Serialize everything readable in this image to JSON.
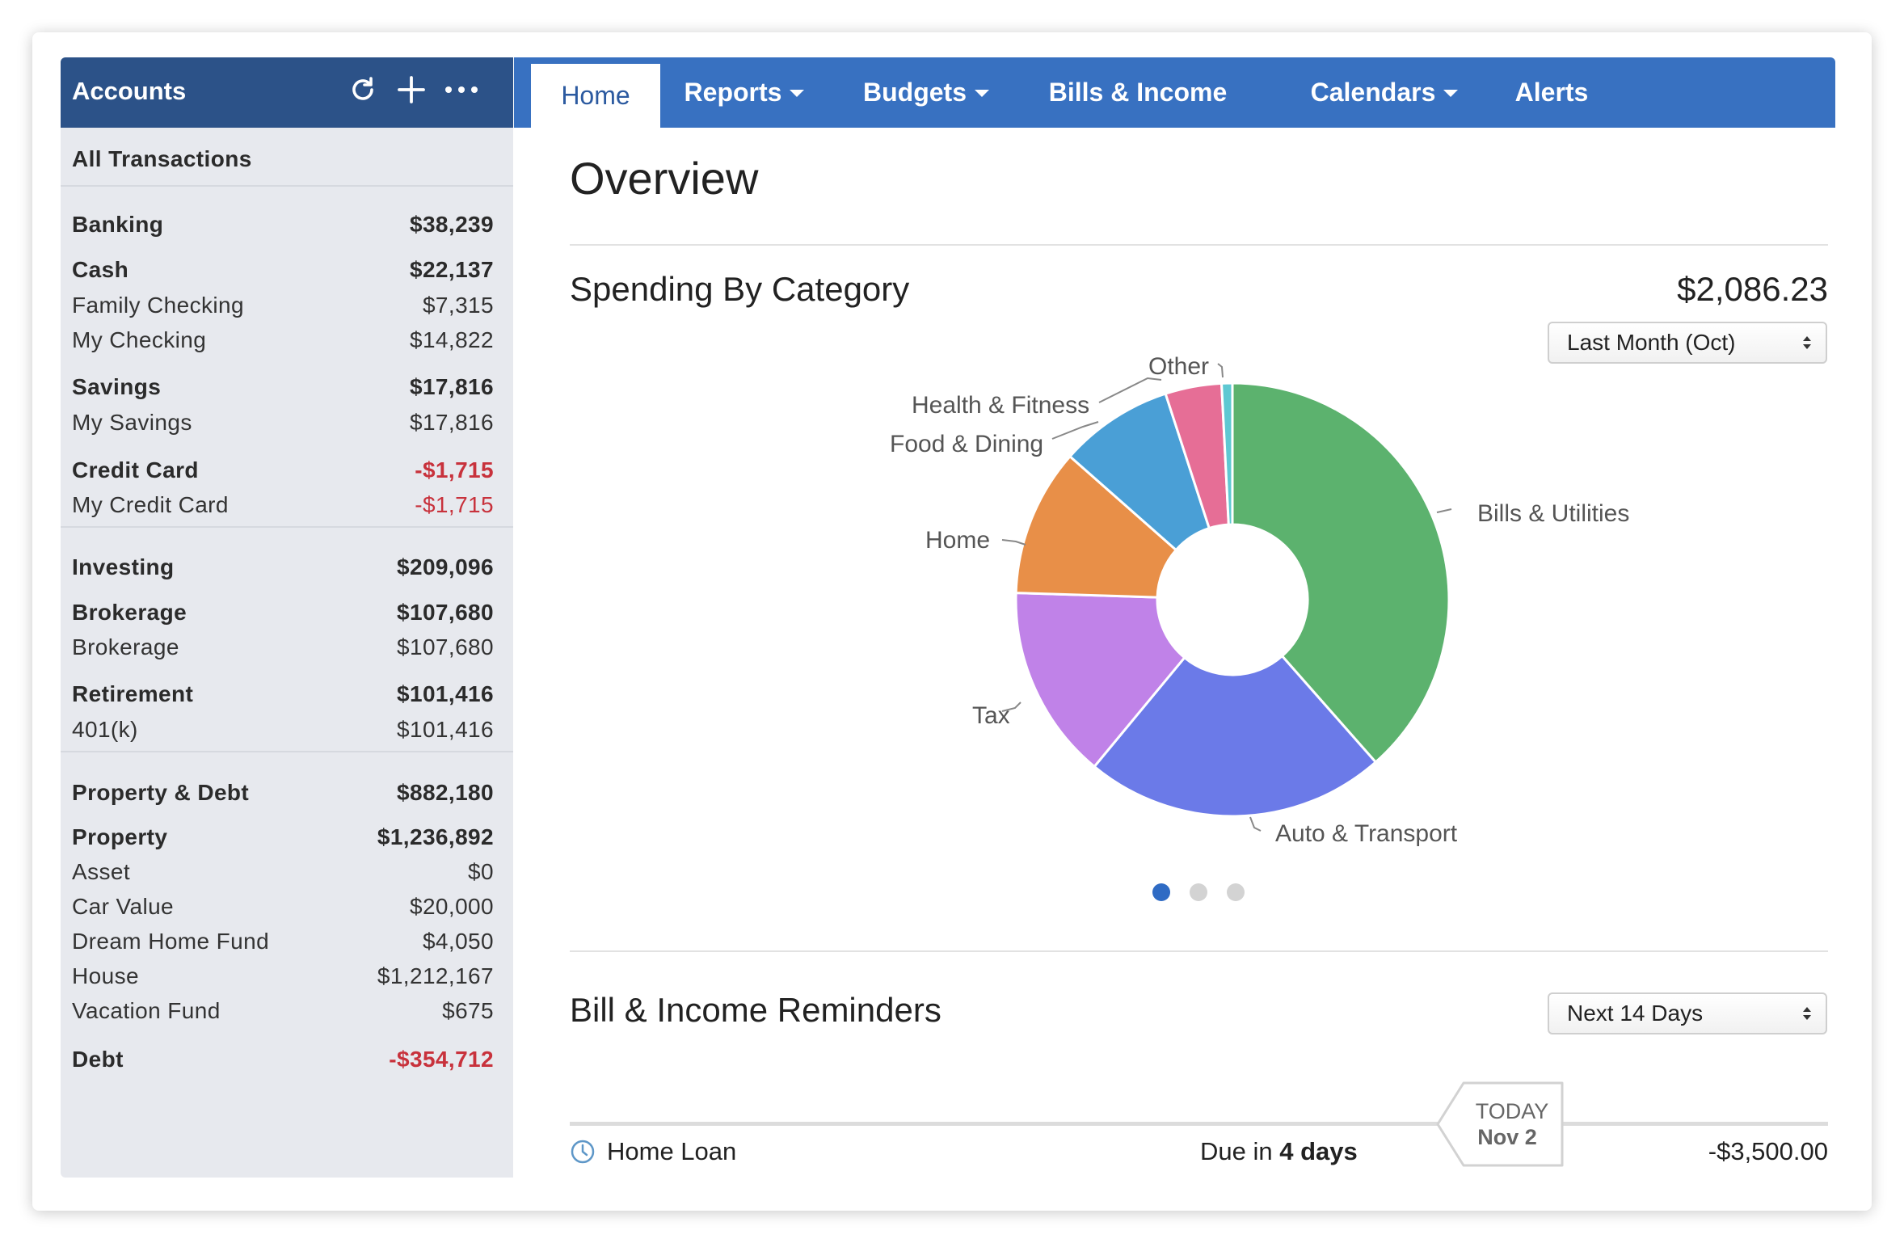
{
  "sidebar": {
    "title": "Accounts",
    "icons": [
      "refresh-icon",
      "plus-icon",
      "more-icon"
    ],
    "all_transactions": "All Transactions",
    "rows": [
      {
        "label": "Banking",
        "value": "$38,239",
        "bold": true,
        "negative": false
      },
      {
        "label": "Cash",
        "value": "$22,137",
        "bold": true,
        "negative": false
      },
      {
        "label": "Family Checking",
        "value": "$7,315",
        "bold": false,
        "negative": false
      },
      {
        "label": "My Checking",
        "value": "$14,822",
        "bold": false,
        "negative": false
      },
      {
        "label": "Savings",
        "value": "$17,816",
        "bold": true,
        "negative": false
      },
      {
        "label": "My Savings",
        "value": "$17,816",
        "bold": false,
        "negative": false
      },
      {
        "label": "Credit Card",
        "value": "-$1,715",
        "bold": true,
        "negative": true
      },
      {
        "label": "My Credit Card",
        "value": "-$1,715",
        "bold": false,
        "negative": true
      },
      {
        "label": "Investing",
        "value": "$209,096",
        "bold": true,
        "negative": false
      },
      {
        "label": "Brokerage",
        "value": "$107,680",
        "bold": true,
        "negative": false
      },
      {
        "label": "Brokerage",
        "value": "$107,680",
        "bold": false,
        "negative": false
      },
      {
        "label": "Retirement",
        "value": "$101,416",
        "bold": true,
        "negative": false
      },
      {
        "label": "401(k)",
        "value": "$101,416",
        "bold": false,
        "negative": false
      },
      {
        "label": "Property & Debt",
        "value": "$882,180",
        "bold": true,
        "negative": false
      },
      {
        "label": "Property",
        "value": "$1,236,892",
        "bold": true,
        "negative": false
      },
      {
        "label": "Asset",
        "value": "$0",
        "bold": false,
        "negative": false
      },
      {
        "label": "Car Value",
        "value": "$20,000",
        "bold": false,
        "negative": false
      },
      {
        "label": "Dream Home Fund",
        "value": "$4,050",
        "bold": false,
        "negative": false
      },
      {
        "label": "House",
        "value": "$1,212,167",
        "bold": false,
        "negative": false
      },
      {
        "label": "Vacation Fund",
        "value": "$675",
        "bold": false,
        "negative": false
      },
      {
        "label": "Debt",
        "value": "-$354,712",
        "bold": true,
        "negative": true
      }
    ]
  },
  "nav": {
    "tabs": [
      {
        "label": "Home",
        "active": true,
        "dropdown": false
      },
      {
        "label": "Reports",
        "active": false,
        "dropdown": true
      },
      {
        "label": "Budgets",
        "active": false,
        "dropdown": true
      },
      {
        "label": "Bills & Income",
        "active": false,
        "dropdown": false
      },
      {
        "label": "Calendars",
        "active": false,
        "dropdown": true
      },
      {
        "label": "Alerts",
        "active": false,
        "dropdown": false
      }
    ]
  },
  "main": {
    "title": "Overview",
    "spending": {
      "title": "Spending By Category",
      "total": "$2,086.23",
      "period": "Last Month (Oct)"
    },
    "reminders": {
      "title": "Bill & Income Reminders",
      "range": "Next 14 Days",
      "today_label": "TODAY",
      "today_date": "Nov 2",
      "item": {
        "name": "Home Loan",
        "due_prefix": "Due in ",
        "due_emphasis": "4 days",
        "amount": "-$3,500.00",
        "icon": "clock-icon"
      }
    },
    "carousel": {
      "pages": 3,
      "active": 0
    }
  },
  "colors": {
    "sidebar_header": "#2c5288",
    "nav": "#3871c1",
    "negative": "#c8323c",
    "active_dot": "#2f6bc4"
  },
  "chart_data": {
    "type": "pie",
    "donut": true,
    "categories": [
      "Bills & Utilities",
      "Auto & Transport",
      "Tax",
      "Home",
      "Food & Dining",
      "Health & Fitness",
      "Other"
    ],
    "values": [
      38.5,
      22.5,
      14.5,
      11.0,
      8.5,
      4.2,
      0.8
    ],
    "colors": [
      "#5cb26e",
      "#6b7ae8",
      "#c082e8",
      "#e88f48",
      "#4a9fd6",
      "#e66e96",
      "#5ec8d2"
    ]
  }
}
